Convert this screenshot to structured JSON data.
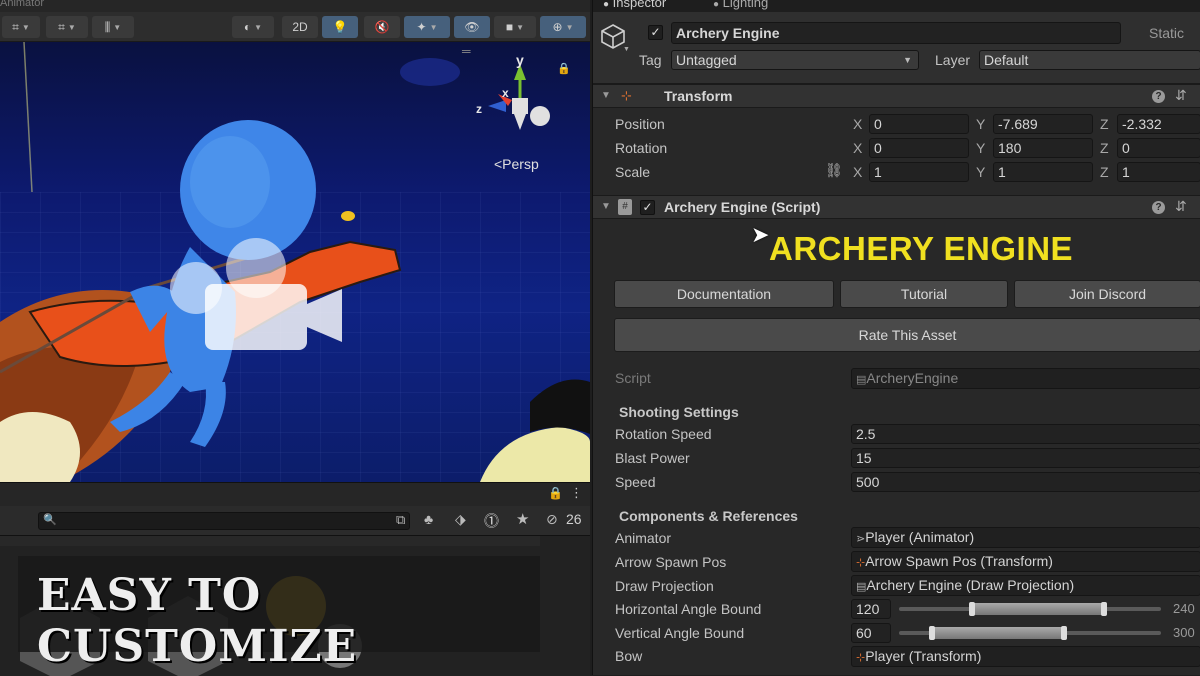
{
  "scene": {
    "tab_title": "Animator",
    "toolbar": {
      "btn_2d": "2D"
    },
    "persp_label": "<Persp",
    "gizmo_axes": {
      "x": "x",
      "y": "y",
      "z": "z"
    },
    "bottom": {
      "hidden_count": "26"
    }
  },
  "banner": {
    "text": "EASY TO CUSTOMIZE"
  },
  "inspector": {
    "tabs": {
      "inspector": "Inspector",
      "lighting": "Lighting"
    },
    "object": {
      "name": "Archery Engine",
      "static_label": "Static",
      "tag_label": "Tag",
      "tag_value": "Untagged",
      "layer_label": "Layer",
      "layer_value": "Default"
    },
    "transform": {
      "title": "Transform",
      "position": {
        "label": "Position",
        "x": "0",
        "y": "-7.689",
        "z": "-2.332"
      },
      "rotation": {
        "label": "Rotation",
        "x": "0",
        "y": "180",
        "z": "0"
      },
      "scale": {
        "label": "Scale",
        "x": "1",
        "y": "1",
        "z": "1"
      }
    },
    "script_component": {
      "title": "Archery Engine (Script)",
      "heading": "ARCHERY ENGINE",
      "buttons": {
        "documentation": "Documentation",
        "tutorial": "Tutorial",
        "discord": "Join Discord",
        "rate": "Rate This Asset"
      },
      "script_label": "Script",
      "script_value": "ArcheryEngine",
      "shooting_header": "Shooting Settings",
      "rotation_speed": {
        "label": "Rotation Speed",
        "value": "2.5"
      },
      "blast_power": {
        "label": "Blast Power",
        "value": "15"
      },
      "speed": {
        "label": "Speed",
        "value": "500"
      },
      "components_header": "Components & References",
      "animator": {
        "label": "Animator",
        "value": "Player (Animator)"
      },
      "arrow_spawn": {
        "label": "Arrow Spawn Pos",
        "value": "Arrow Spawn Pos (Transform)"
      },
      "draw_projection": {
        "label": "Draw Projection",
        "value": "Archery Engine (Draw Projection)"
      },
      "h_angle": {
        "label": "Horizontal Angle Bound",
        "value": "120",
        "max": "240"
      },
      "v_angle": {
        "label": "Vertical Angle Bound",
        "value": "60",
        "max": "300"
      },
      "bow": {
        "label": "Bow",
        "value": "Player (Transform)"
      }
    }
  },
  "colors": {
    "accent_yellow": "#f0e020",
    "toolbar_active": "#46607c",
    "sky": "#0f2384"
  },
  "icons": [
    "grid-icon",
    "snap-icon",
    "shading-icon",
    "light-icon",
    "audio-icon",
    "effects-icon",
    "visibility-icon",
    "camera-icon",
    "gizmo-icon",
    "lock-icon",
    "menu-icon",
    "search-icon",
    "cube-icon",
    "transform-icon",
    "script-icon",
    "help-icon",
    "settings-icon",
    "link-icon",
    "animator-icon",
    "transform-small-icon",
    "script-small-icon"
  ]
}
